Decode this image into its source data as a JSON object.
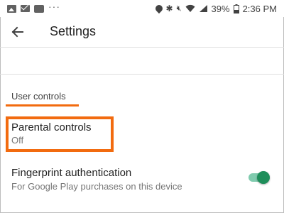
{
  "status_bar": {
    "left_icons": [
      "image-icon",
      "mail-icon",
      "message-icon",
      "more-dots-icon"
    ],
    "right_icons": [
      "location-icon",
      "bluetooth-icon",
      "mute-icon",
      "wifi-icon",
      "signal-icon"
    ],
    "battery": "39%",
    "time": "2:36 PM"
  },
  "app_bar": {
    "back_icon": "arrow-back-icon",
    "title": "Settings"
  },
  "section": {
    "header": "User controls"
  },
  "parental_controls": {
    "title": "Parental controls",
    "subtitle": "Off"
  },
  "fingerprint": {
    "title": "Fingerprint authentication",
    "subtitle": "For Google Play purchases on this device",
    "enabled": true
  },
  "colors": {
    "highlight": "#f26b0f",
    "toggle_on": "#1e8e5a"
  }
}
